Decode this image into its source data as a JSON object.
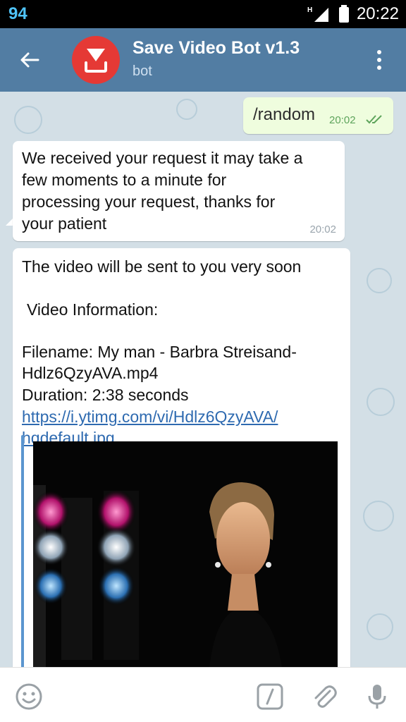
{
  "status_bar": {
    "left_number": "94",
    "signal_label": "H",
    "time": "20:22"
  },
  "header": {
    "title": "Save Video Bot v1.3",
    "subtitle": "bot"
  },
  "messages": [
    {
      "text": "/random",
      "time": "20:02"
    },
    {
      "lines": [
        "We received your request it may take a",
        "few moments to a minute for",
        "processing your request, thanks for",
        "your patient"
      ],
      "time": "20:02"
    },
    {
      "line1": "The video will be sent to you very soon",
      "info_heading": "Video Information:",
      "filename_line1": "Filename: My man - Barbra Streisand-",
      "filename_line2": "Hdlz6QzyAVA.mp4",
      "duration": "Duration: 2:38 seconds",
      "link_line1": "https://i.ytimg.com/vi/Hdlz6QzyAVA/",
      "link_line2": "hqdefault.jpg"
    }
  ],
  "colors": {
    "header": "#527da3",
    "chat_bg": "#d3dfe6",
    "outgoing_bubble": "#effdde",
    "link": "#2e6ab0",
    "avatar": "#e53935"
  },
  "icons": {
    "back": "arrow-left-icon",
    "menu": "more-vert-icon",
    "emoji": "emoji-icon",
    "commands": "slash-command-icon",
    "attach": "paperclip-icon",
    "mic": "microphone-icon"
  }
}
